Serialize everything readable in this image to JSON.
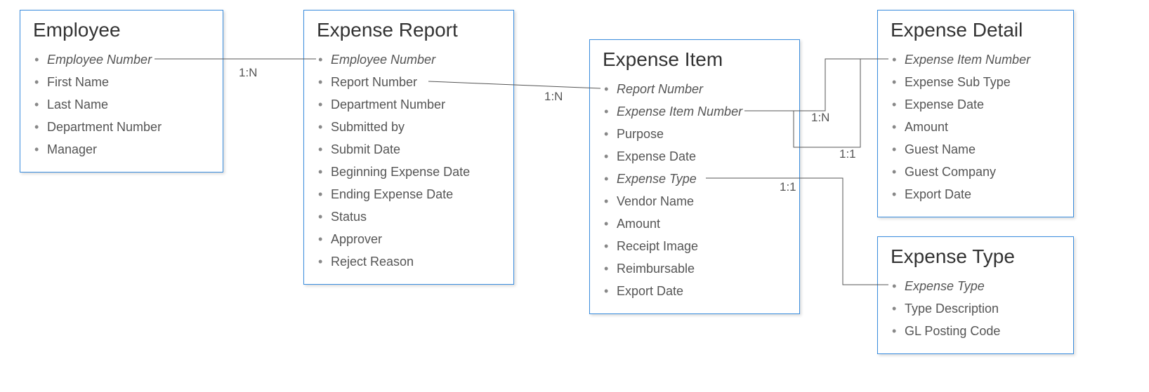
{
  "entities": {
    "employee": {
      "title": "Employee",
      "attrs": [
        {
          "label": "Employee Number",
          "key": true
        },
        {
          "label": "First Name",
          "key": false
        },
        {
          "label": "Last Name",
          "key": false
        },
        {
          "label": "Department Number",
          "key": false
        },
        {
          "label": "Manager",
          "key": false
        }
      ]
    },
    "expenseReport": {
      "title": "Expense Report",
      "attrs": [
        {
          "label": "Employee Number",
          "key": true
        },
        {
          "label": "Report Number",
          "key": false
        },
        {
          "label": "Department Number",
          "key": false
        },
        {
          "label": "Submitted by",
          "key": false
        },
        {
          "label": "Submit Date",
          "key": false
        },
        {
          "label": "Beginning Expense Date",
          "key": false
        },
        {
          "label": "Ending Expense Date",
          "key": false
        },
        {
          "label": "Status",
          "key": false
        },
        {
          "label": "Approver",
          "key": false
        },
        {
          "label": "Reject Reason",
          "key": false
        }
      ]
    },
    "expenseItem": {
      "title": "Expense Item",
      "attrs": [
        {
          "label": "Report Number",
          "key": true
        },
        {
          "label": "Expense Item Number",
          "key": true
        },
        {
          "label": "Purpose",
          "key": false
        },
        {
          "label": "Expense Date",
          "key": false
        },
        {
          "label": "Expense Type",
          "key": true
        },
        {
          "label": "Vendor Name",
          "key": false
        },
        {
          "label": "Amount",
          "key": false
        },
        {
          "label": "Receipt Image",
          "key": false
        },
        {
          "label": "Reimbursable",
          "key": false
        },
        {
          "label": "Export Date",
          "key": false
        }
      ]
    },
    "expenseDetail": {
      "title": "Expense Detail",
      "attrs": [
        {
          "label": "Expense Item Number",
          "key": true
        },
        {
          "label": "Expense Sub Type",
          "key": false
        },
        {
          "label": "Expense Date",
          "key": false
        },
        {
          "label": "Amount",
          "key": false
        },
        {
          "label": "Guest Name",
          "key": false
        },
        {
          "label": "Guest Company",
          "key": false
        },
        {
          "label": "Export Date",
          "key": false
        }
      ]
    },
    "expenseType": {
      "title": "Expense Type",
      "attrs": [
        {
          "label": "Expense Type",
          "key": true
        },
        {
          "label": "Type Description",
          "key": false
        },
        {
          "label": "GL Posting Code",
          "key": false
        }
      ]
    }
  },
  "relationships": {
    "emp_to_report": "1:N",
    "report_to_item": "1:N",
    "item_to_detail": "1:N",
    "item_to_detail2": "1:1",
    "item_to_type": "1:1"
  }
}
